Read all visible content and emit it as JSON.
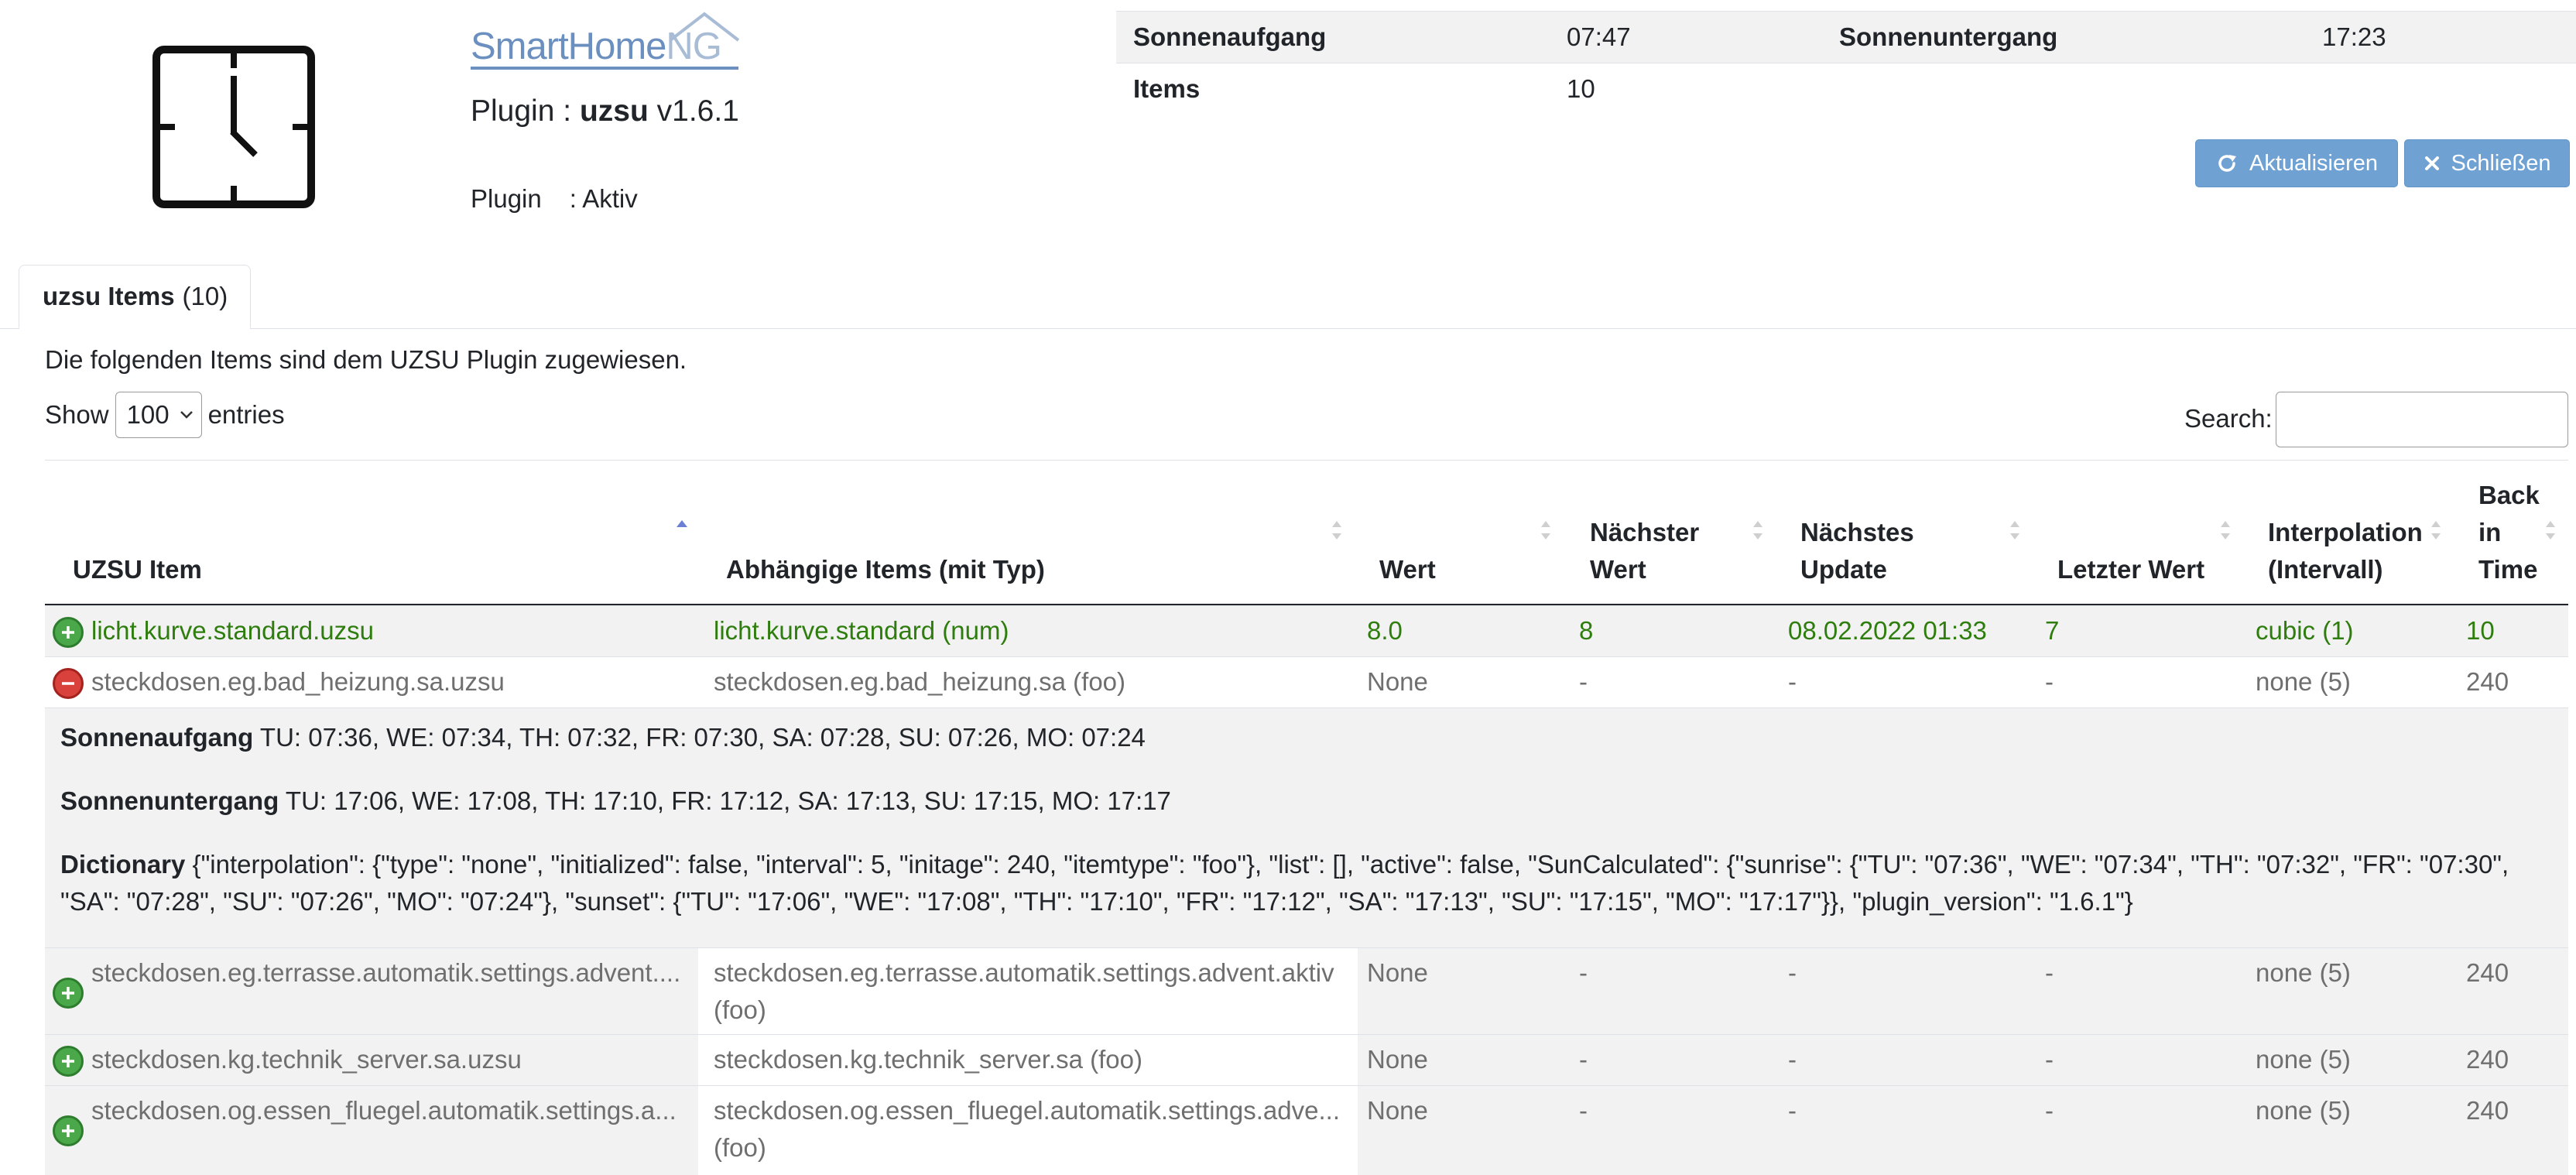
{
  "brand": {
    "logo_text_main": "SmartHome",
    "logo_text_suffix": "NG"
  },
  "plugin": {
    "title_prefix": "Plugin :",
    "name": "uzsu",
    "version": "v1.6.1",
    "status_label": "Plugin",
    "status_value": ": Aktiv"
  },
  "info": {
    "sunrise_label": "Sonnenaufgang",
    "sunrise_value": "07:47",
    "sunset_label": "Sonnenuntergang",
    "sunset_value": "17:23",
    "items_label": "Items",
    "items_value": "10"
  },
  "buttons": {
    "refresh": "Aktualisieren",
    "close": "Schließen"
  },
  "tab": {
    "label": "uzsu Items",
    "count": "(10)"
  },
  "description": "Die folgenden Items sind dem UZSU Plugin zugewiesen.",
  "length_control": {
    "show": "Show",
    "value": "100",
    "entries": "entries"
  },
  "search": {
    "label": "Search:",
    "value": ""
  },
  "table": {
    "headers": {
      "item": "UZSU Item",
      "dependent": "Abhängige Items (mit Typ)",
      "value": "Wert",
      "next_value_1": "Nächster",
      "next_value_2": "Wert",
      "next_update_1": "Nächstes",
      "next_update_2": "Update",
      "last_value": "Letzter Wert",
      "interp_1": "Interpolation",
      "interp_2": "(Intervall)",
      "back_1": "Back",
      "back_2": "in",
      "back_3": "Time"
    },
    "rows": [
      {
        "item": "licht.kurve.standard.uzsu",
        "dependent": "licht.kurve.standard (num)",
        "dependent2": "",
        "value": "8.0",
        "next_value": "8",
        "next_update": "08.02.2022 01:33",
        "last_value": "7",
        "interpolation": "cubic (1)",
        "back_in_time": "10"
      },
      {
        "item": "steckdosen.eg.bad_heizung.sa.uzsu",
        "dependent": "steckdosen.eg.bad_heizung.sa (foo)",
        "dependent2": "",
        "value": "None",
        "next_value": "-",
        "next_update": "-",
        "last_value": "-",
        "interpolation": "none (5)",
        "back_in_time": "240"
      },
      {
        "item": "steckdosen.eg.terrasse.automatik.settings.advent....",
        "dependent": "steckdosen.eg.terrasse.automatik.settings.advent.aktiv",
        "dependent2": "(foo)",
        "value": "None",
        "next_value": "-",
        "next_update": "-",
        "last_value": "-",
        "interpolation": "none (5)",
        "back_in_time": "240"
      },
      {
        "item": "steckdosen.kg.technik_server.sa.uzsu",
        "dependent": "steckdosen.kg.technik_server.sa (foo)",
        "dependent2": "",
        "value": "None",
        "next_value": "-",
        "next_update": "-",
        "last_value": "-",
        "interpolation": "none (5)",
        "back_in_time": "240"
      },
      {
        "item": "steckdosen.og.essen_fluegel.automatik.settings.a...",
        "dependent": "steckdosen.og.essen_fluegel.automatik.settings.adve...",
        "dependent2": "(foo)",
        "value": "None",
        "next_value": "-",
        "next_update": "-",
        "last_value": "-",
        "interpolation": "none (5)",
        "back_in_time": "240"
      }
    ],
    "detail": {
      "sunrise_label": "Sonnenaufgang",
      "sunrise_text": "TU: 07:36, WE: 07:34, TH: 07:32, FR: 07:30, SA: 07:28, SU: 07:26, MO: 07:24",
      "sunset_label": "Sonnenuntergang",
      "sunset_text": "TU: 17:06, WE: 17:08, TH: 17:10, FR: 17:12, SA: 17:13, SU: 17:15, MO: 17:17",
      "dict_label": "Dictionary",
      "dict_line1": "{\"interpolation\": {\"type\": \"none\", \"initialized\": false, \"interval\": 5, \"initage\": 240, \"itemtype\": \"foo\"}, \"list\": [], \"active\": false, \"SunCalculated\": {\"sunrise\": {\"TU\": \"07:36\", \"WE\": \"07:34\", \"TH\": \"07:32\", \"FR\": \"07:30\",",
      "dict_line2": "\"SA\": \"07:28\", \"SU\": \"07:26\", \"MO\": \"07:24\"}, \"sunset\": {\"TU\": \"17:06\", \"WE\": \"17:08\", \"TH\": \"17:10\", \"FR\": \"17:12\", \"SA\": \"17:13\", \"SU\": \"17:15\", \"MO\": \"17:17\"}}, \"plugin_version\": \"1.6.1\"}"
    }
  },
  "colors": {
    "active_row_text": "#2e7d0e",
    "inactive_row_text": "#6f6f6f",
    "button_bg": "#6fa1d3",
    "expand_icon": "#4aa84a",
    "collapse_icon": "#d9413c"
  },
  "icons": {
    "plugin": "clock-icon",
    "refresh": "refresh-icon",
    "close": "close-icon",
    "expand": "plus-circle-icon",
    "collapse": "minus-circle-icon"
  }
}
